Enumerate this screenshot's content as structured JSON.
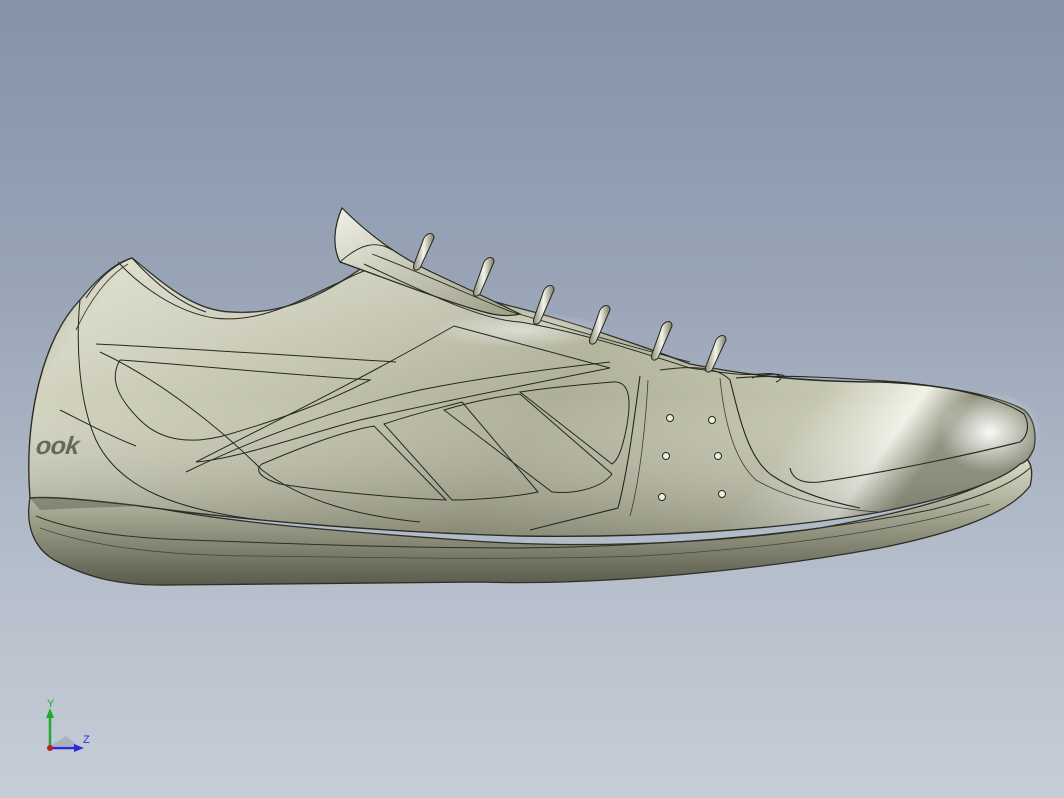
{
  "viewport": {
    "model": "shoe",
    "brand_text": "ook",
    "background_top": "#8593a8",
    "background_bottom": "#c6cdd7"
  },
  "triad": {
    "y_label": "Y",
    "z_label": "Z",
    "y_color": "#1cae2a",
    "z_color": "#2a2adf",
    "origin_color": "#d01818"
  }
}
